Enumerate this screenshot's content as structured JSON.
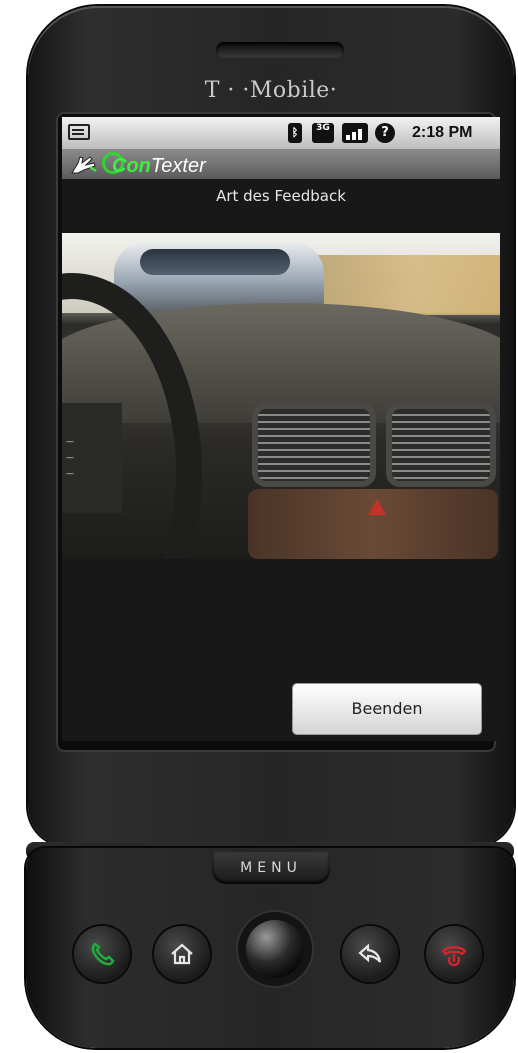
{
  "device": {
    "carrier_logo": "T · ·Mobile·",
    "menu_key_label": "MENU"
  },
  "status_bar": {
    "time": "2:18 PM",
    "icons": [
      "notification-icon",
      "bluetooth-icon",
      "3g-icon",
      "signal-icon",
      "help-icon"
    ],
    "network_label": "3G"
  },
  "app": {
    "title_prefix": "Con",
    "title_suffix": "Texter",
    "subtitle": "Art des Feedback"
  },
  "camera_view": {
    "description_icon": "camera-feed"
  },
  "actions": {
    "end_label": "Beenden"
  },
  "hardware_keys": [
    "call-icon",
    "home-icon",
    "trackball",
    "back-icon",
    "end-call-icon"
  ],
  "colors": {
    "accent_green": "#3cf03c",
    "call_green": "#1fae3a",
    "end_red": "#d8252b"
  }
}
